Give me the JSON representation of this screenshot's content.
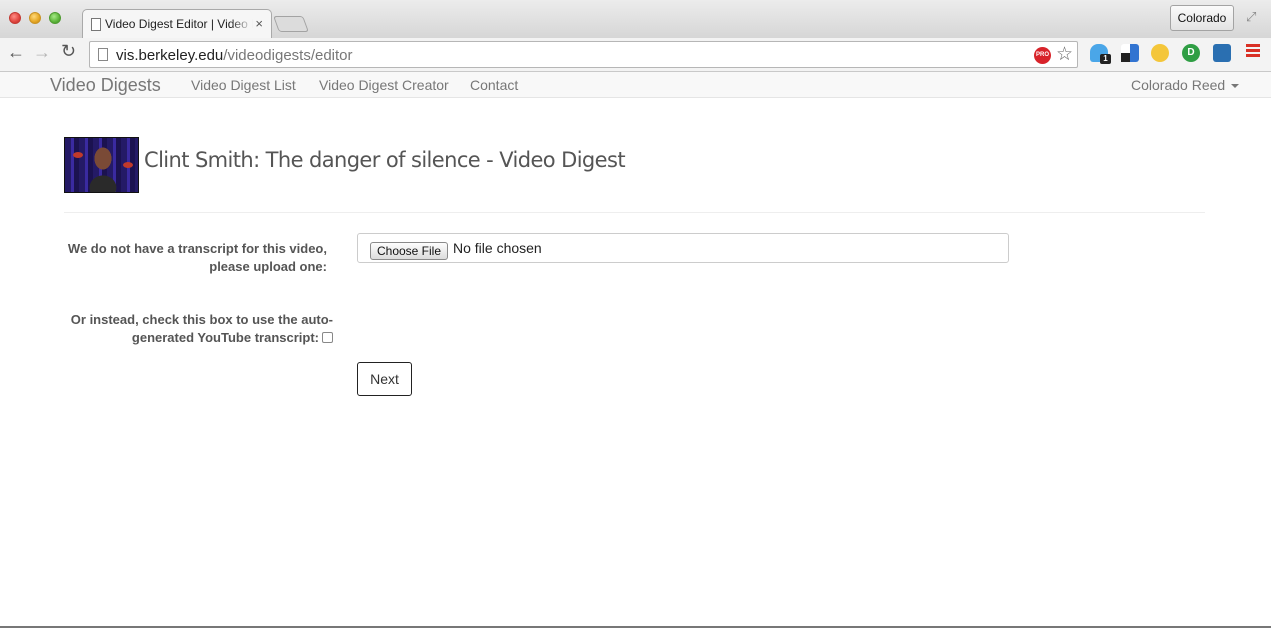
{
  "browser": {
    "tab_title": "Video Digest Editor | Video Digests",
    "tab_close": "×",
    "profile_name": "Colorado",
    "url_host": "vis.berkeley.edu",
    "url_path": "/videodigests/editor",
    "pro_badge": "PRO",
    "ghost_badge": "1",
    "id_ext_label": "D",
    "back_glyph": "←",
    "forward_glyph": "→",
    "reload_glyph": "↻",
    "star_glyph": "☆",
    "fullscreen_glyph": "⤢",
    "icons": [
      "back-icon",
      "forward-icon",
      "reload-icon",
      "page-icon",
      "pro-icon",
      "star-icon",
      "ghostery-icon",
      "delicious-icon",
      "lastpass-icon",
      "id-extension-icon",
      "extension-icon",
      "menu-icon",
      "fullscreen-icon"
    ]
  },
  "navbar": {
    "brand": "Video Digests",
    "links": [
      "Video Digest List",
      "Video Digest Creator",
      "Contact"
    ],
    "user": "Colorado Reed"
  },
  "main": {
    "title": "Clint Smith: The danger of silence - Video Digest",
    "upload_label": "We do not have a transcript for this video, please upload one:",
    "choose_file_label": "Choose File",
    "file_status": "No file chosen",
    "youtube_label": "Or instead, check this box to use the auto-generated YouTube transcript:",
    "youtube_checked": false,
    "next_label": "Next"
  },
  "colors": {
    "nav_text": "#777777",
    "title_text": "#555555",
    "pro_red": "#d8232a"
  }
}
